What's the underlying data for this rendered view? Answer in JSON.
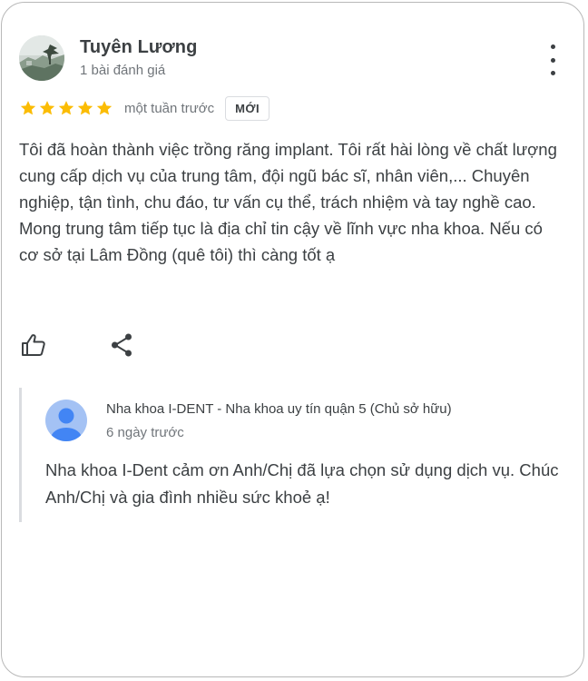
{
  "reviewer": {
    "name": "Tuyên Lương",
    "review_count": "1 bài đánh giá"
  },
  "rating": {
    "stars": 5,
    "max_stars": 5,
    "star_color": "#fbbc04",
    "time_ago": "một tuần trước",
    "new_badge": "MỚI"
  },
  "review": {
    "text": "Tôi đã hoàn thành việc trồng răng implant. Tôi rất hài lòng về chất lượng cung cấp dịch vụ của trung tâm, đội ngũ bác sĩ, nhân viên,... Chuyên nghiệp, tận tình, chu đáo, tư vấn cụ thể, trách nhiệm và tay nghề cao. Mong trung tâm tiếp tục là địa chỉ tin cậy về lĩnh vực nha khoa. Nếu có cơ sở tại Lâm Đồng (quê tôi) thì càng tốt ạ"
  },
  "actions": {
    "like_icon": "thumb-up-icon",
    "share_icon": "share-icon",
    "menu_icon": "more-vert-icon"
  },
  "owner_reply": {
    "name": "Nha khoa I-DENT - Nha khoa uy tín quận 5 (Chủ sở hữu)",
    "time_ago": "6 ngày trước",
    "text": "Nha khoa I-Dent cảm ơn Anh/Chị đã lựa chọn sử dụng dịch vụ. Chúc Anh/Chị và gia đình nhiều sức khoẻ ạ!",
    "avatar_color": "#4285f4"
  }
}
